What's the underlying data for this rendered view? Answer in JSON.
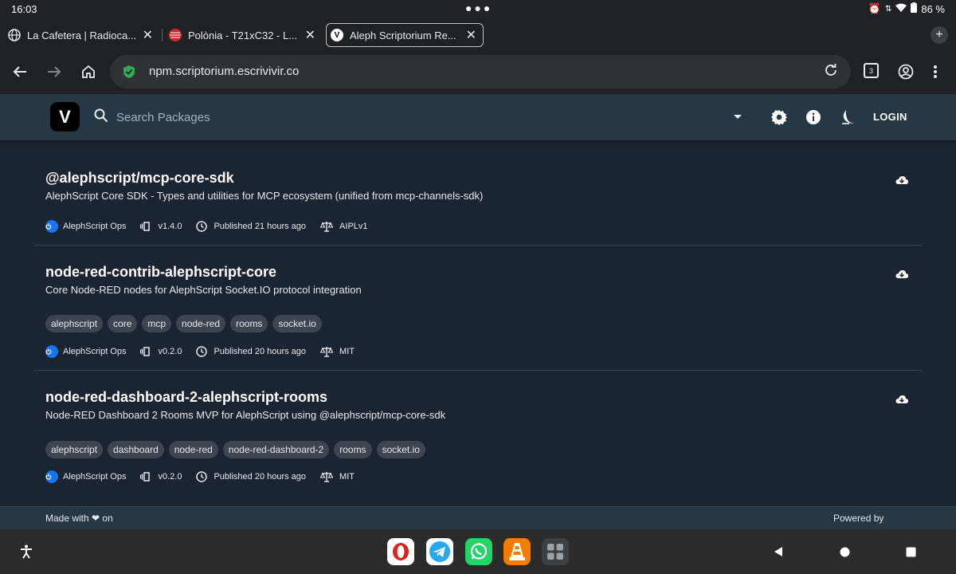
{
  "status_bar": {
    "time": "16:03",
    "battery": "86 %"
  },
  "tabs": [
    {
      "title": "La Cafetera | Radioca...",
      "active": false
    },
    {
      "title": "Polònia - T21xC32 - L...",
      "active": false
    },
    {
      "title": "Aleph Scriptorium Re...",
      "active": true
    }
  ],
  "toolbar": {
    "url": "npm.scriptorium.escrivivir.co",
    "tab_count": "3"
  },
  "appbar": {
    "logo": "V",
    "search_placeholder": "Search Packages",
    "login_label": "LOGIN"
  },
  "packages": [
    {
      "name": "@alephscript/mcp-core-sdk",
      "description": "AlephScript Core SDK - Types and utilities for MCP ecosystem (unified from mcp-channels-sdk)",
      "tags": [],
      "author": "AlephScript Ops",
      "version": "v1.4.0",
      "published": "Published 21 hours ago",
      "license": "AIPLv1"
    },
    {
      "name": "node-red-contrib-alephscript-core",
      "description": "Core Node-RED nodes for AlephScript Socket.IO protocol integration",
      "tags": [
        "alephscript",
        "core",
        "mcp",
        "node-red",
        "rooms",
        "socket.io"
      ],
      "author": "AlephScript Ops",
      "version": "v0.2.0",
      "published": "Published 20 hours ago",
      "license": "MIT"
    },
    {
      "name": "node-red-dashboard-2-alephscript-rooms",
      "description": "Node-RED Dashboard 2 Rooms MVP for AlephScript using @alephscript/mcp-core-sdk",
      "tags": [
        "alephscript",
        "dashboard",
        "node-red",
        "node-red-dashboard-2",
        "rooms",
        "socket.io"
      ],
      "author": "AlephScript Ops",
      "version": "v0.2.0",
      "published": "Published 20 hours ago",
      "license": "MIT"
    }
  ],
  "footer": {
    "made_with": "Made with ❤ on",
    "powered_by": "Powered by"
  },
  "colors": {
    "appbar": "#263746",
    "content_bg": "#1b2431",
    "tag_bg": "#3c4550",
    "accent": "#1a73e8"
  }
}
